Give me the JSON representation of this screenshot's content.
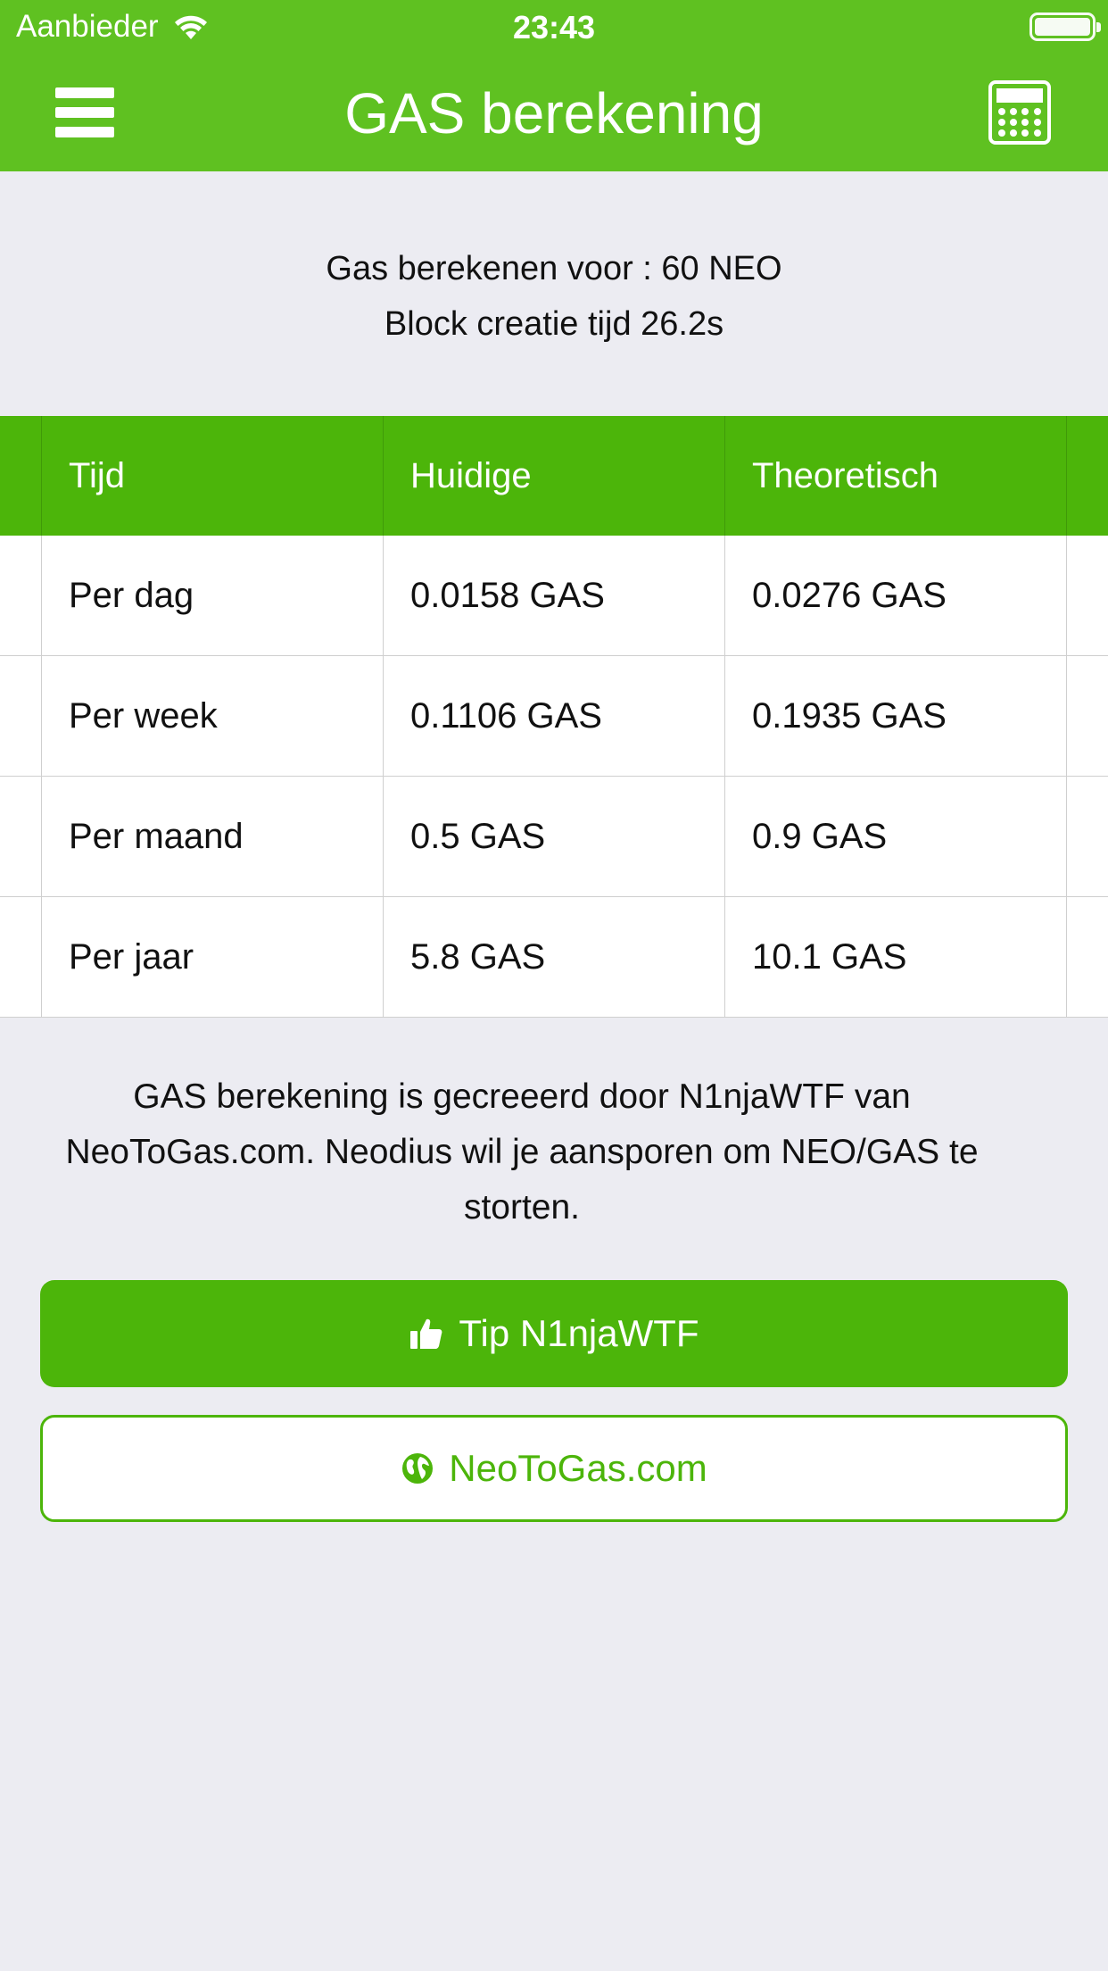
{
  "status_bar": {
    "carrier": "Aanbieder",
    "time": "23:43"
  },
  "nav": {
    "title": "GAS berekening",
    "menu_icon": "hamburger-menu-icon",
    "right_icon": "calculator-icon"
  },
  "info": {
    "line1": "Gas berekenen voor : 60 NEO",
    "line2": "Block creatie tijd 26.2s"
  },
  "table": {
    "headers": [
      "Tijd",
      "Huidige",
      "Theoretisch"
    ],
    "rows": [
      [
        "Per dag",
        "0.0158 GAS",
        "0.0276 GAS"
      ],
      [
        "Per week",
        "0.1106 GAS",
        "0.1935 GAS"
      ],
      [
        "Per maand",
        "0.5 GAS",
        "0.9 GAS"
      ],
      [
        "Per jaar",
        "5.8 GAS",
        "10.1 GAS"
      ]
    ]
  },
  "footer": {
    "text": "GAS berekening is gecreeerd door N1njaWTF  van NeoToGas.com. Neodius wil je aansporen om NEO/GAS te storten."
  },
  "buttons": {
    "tip_label": "Tip N1njaWTF",
    "tip_icon": "thumbs-up-icon",
    "site_label": "NeoToGas.com",
    "site_icon": "globe-icon"
  },
  "colors": {
    "nav_green": "#5fc121",
    "accent_green": "#4cb50a",
    "background": "#ececf2"
  }
}
